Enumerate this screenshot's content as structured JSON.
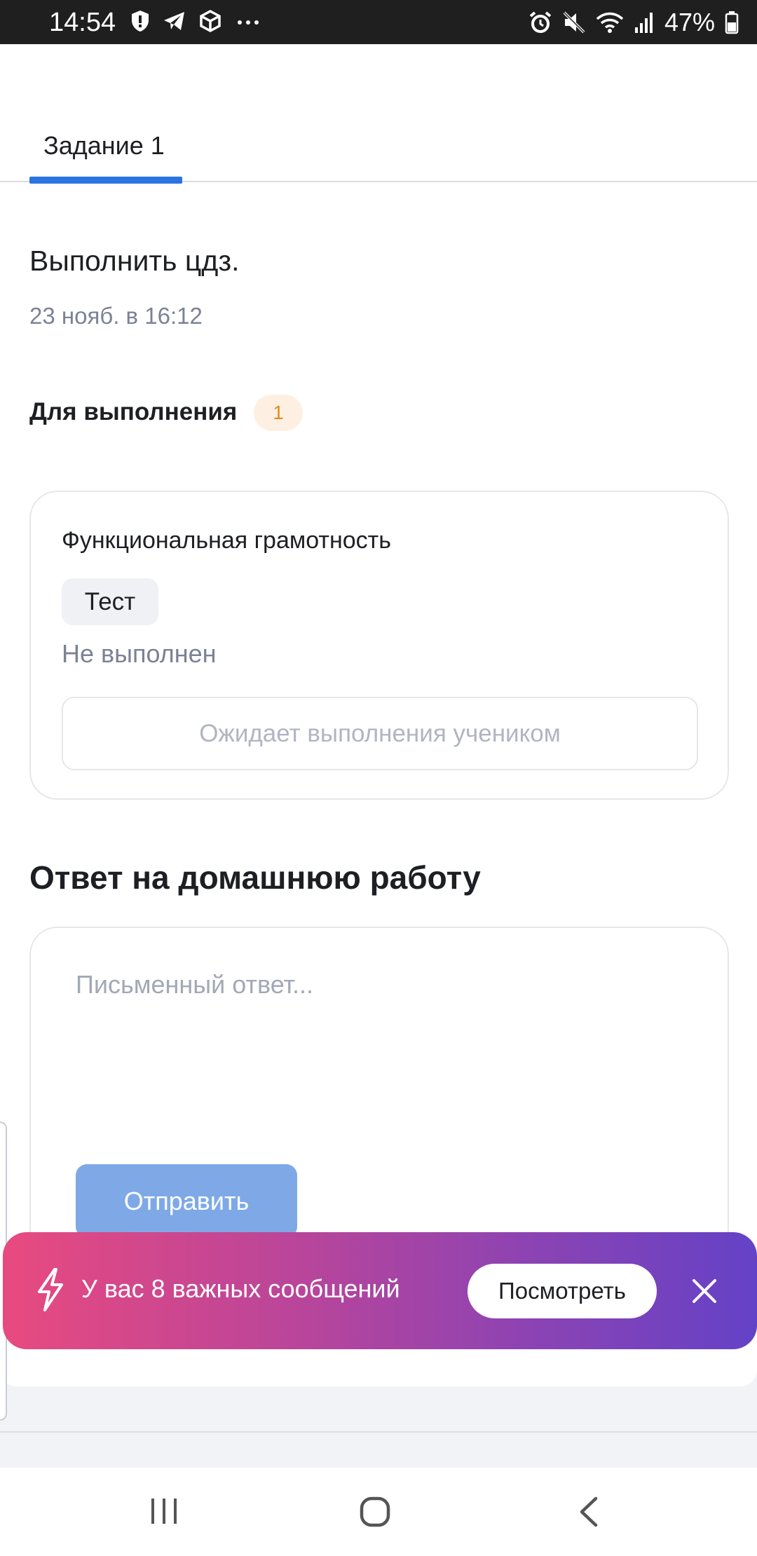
{
  "status_bar": {
    "time": "14:54",
    "battery": "47%",
    "left_icons": [
      "shield-icon",
      "telegram-icon",
      "package-icon",
      "more-icon"
    ],
    "right_icons": [
      "alarm-icon",
      "mute-icon",
      "wifi-icon",
      "signal-icon",
      "battery-icon"
    ]
  },
  "tabs": [
    {
      "label": "Задание 1",
      "active": true
    }
  ],
  "task": {
    "title": "Выполнить цдз.",
    "date": "23 нояб. в 16:12"
  },
  "todo": {
    "label": "Для выполнения",
    "count": "1",
    "item": {
      "subject": "Функциональная грамотность",
      "type": "Тест",
      "status": "Не выполнен",
      "await_label": "Ожидает выполнения учеником"
    }
  },
  "answer": {
    "heading": "Ответ на домашнюю работу",
    "placeholder": "Письменный ответ...",
    "value": "",
    "send_label": "Отправить"
  },
  "banner": {
    "text": "У вас 8 важных сообщений",
    "button_label": "Посмотреть",
    "icon": "lightning-icon"
  },
  "colors": {
    "accent": "#2b74e2",
    "send_button": "#7ea9e6",
    "badge_text": "#e68a22",
    "banner_gradient_start": "#e84a7f",
    "banner_gradient_end": "#6442c7"
  },
  "navbar": [
    "recent-apps-icon",
    "home-icon",
    "back-icon"
  ]
}
